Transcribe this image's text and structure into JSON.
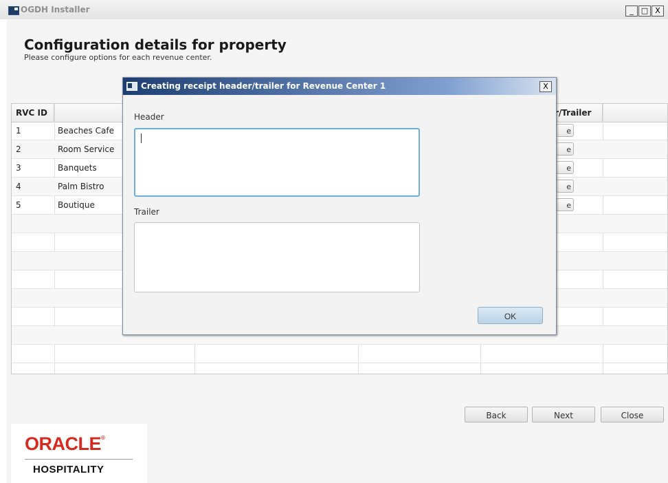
{
  "window": {
    "title": "OGDH Installer",
    "controls": {
      "minimize": "_",
      "maximize": "□",
      "close": "X"
    }
  },
  "page": {
    "title": "Configuration details for property",
    "subtitle": "Please configure options for each revenue center."
  },
  "table": {
    "columns": [
      "RVC ID",
      "RVC",
      "",
      "",
      "r/Trailer",
      ""
    ],
    "rows": [
      {
        "id": "1",
        "name": "Beaches Cafe",
        "button": "e"
      },
      {
        "id": "2",
        "name": "Room Service",
        "button": "e"
      },
      {
        "id": "3",
        "name": "Banquets",
        "button": "e"
      },
      {
        "id": "4",
        "name": "Palm Bistro",
        "button": "e"
      },
      {
        "id": "5",
        "name": "Boutique",
        "button": "e"
      }
    ]
  },
  "dialog": {
    "title": "Creating receipt header/trailer for Revenue Center 1",
    "close": "X",
    "header_label": "Header",
    "header_value": "",
    "trailer_label": "Trailer",
    "trailer_value": "",
    "ok_label": "OK"
  },
  "nav": {
    "back": "Back",
    "next": "Next",
    "close": "Close"
  },
  "logo": {
    "brand": "ORACLE",
    "sub": "HOSPITALITY"
  },
  "colors": {
    "brand_red": "#d52b1e",
    "dialog_title_start": "#1d3e72",
    "focus_border": "#6cb1dd"
  }
}
